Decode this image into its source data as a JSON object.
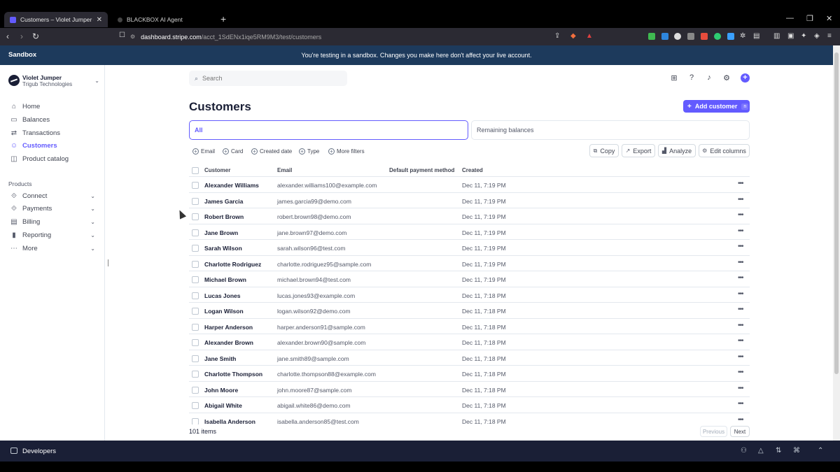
{
  "browser": {
    "tabs": [
      {
        "title": "Customers – Violet Jumper – Stri",
        "active": true
      },
      {
        "title": "BLACKBOX AI Agent",
        "active": false
      }
    ],
    "url_host": "dashboard.stripe.com",
    "url_path": "/acct_1SdENx1iqe5RM9M3/test/customers"
  },
  "banner": {
    "label": "Sandbox",
    "message": "You're testing in a sandbox. Changes you make here don't affect your live account."
  },
  "account": {
    "name": "Violet Jumper",
    "company": "Trigub Technologies"
  },
  "sidebar": {
    "items": [
      {
        "label": "Home",
        "icon": "home-icon"
      },
      {
        "label": "Balances",
        "icon": "balances-icon"
      },
      {
        "label": "Transactions",
        "icon": "transactions-icon"
      },
      {
        "label": "Customers",
        "icon": "customers-icon",
        "active": true
      },
      {
        "label": "Product catalog",
        "icon": "product-catalog-icon"
      }
    ],
    "products_label": "Products",
    "products": [
      {
        "label": "Connect",
        "icon": "connect-icon"
      },
      {
        "label": "Payments",
        "icon": "payments-icon"
      },
      {
        "label": "Billing",
        "icon": "billing-icon"
      },
      {
        "label": "Reporting",
        "icon": "reporting-icon"
      },
      {
        "label": "More",
        "icon": "more-icon"
      }
    ]
  },
  "search": {
    "placeholder": "Search"
  },
  "page": {
    "title": "Customers",
    "add_button": "Add customer",
    "add_shortcut": "n"
  },
  "segments": {
    "all": "All",
    "remaining": "Remaining balances"
  },
  "filters": [
    "Email",
    "Card",
    "Created date",
    "Type",
    "More filters"
  ],
  "actions": [
    "Copy",
    "Export",
    "Analyze",
    "Edit columns"
  ],
  "table": {
    "columns": [
      "Customer",
      "Email",
      "Default payment method",
      "Created"
    ],
    "rows": [
      {
        "name": "Alexander Williams",
        "email": "alexander.williams100@example.com",
        "created": "Dec 11, 7:19 PM"
      },
      {
        "name": "James Garcia",
        "email": "james.garcia99@demo.com",
        "created": "Dec 11, 7:19 PM"
      },
      {
        "name": "Robert Brown",
        "email": "robert.brown98@demo.com",
        "created": "Dec 11, 7:19 PM"
      },
      {
        "name": "Jane Brown",
        "email": "jane.brown97@demo.com",
        "created": "Dec 11, 7:19 PM"
      },
      {
        "name": "Sarah Wilson",
        "email": "sarah.wilson96@test.com",
        "created": "Dec 11, 7:19 PM"
      },
      {
        "name": "Charlotte Rodriguez",
        "email": "charlotte.rodriguez95@sample.com",
        "created": "Dec 11, 7:19 PM"
      },
      {
        "name": "Michael Brown",
        "email": "michael.brown94@test.com",
        "created": "Dec 11, 7:19 PM"
      },
      {
        "name": "Lucas Jones",
        "email": "lucas.jones93@example.com",
        "created": "Dec 11, 7:18 PM"
      },
      {
        "name": "Logan Wilson",
        "email": "logan.wilson92@demo.com",
        "created": "Dec 11, 7:18 PM"
      },
      {
        "name": "Harper Anderson",
        "email": "harper.anderson91@sample.com",
        "created": "Dec 11, 7:18 PM"
      },
      {
        "name": "Alexander Brown",
        "email": "alexander.brown90@sample.com",
        "created": "Dec 11, 7:18 PM"
      },
      {
        "name": "Jane Smith",
        "email": "jane.smith89@sample.com",
        "created": "Dec 11, 7:18 PM"
      },
      {
        "name": "Charlotte Thompson",
        "email": "charlotte.thompson88@example.com",
        "created": "Dec 11, 7:18 PM"
      },
      {
        "name": "John Moore",
        "email": "john.moore87@sample.com",
        "created": "Dec 11, 7:18 PM"
      },
      {
        "name": "Abigail White",
        "email": "abigail.white86@demo.com",
        "created": "Dec 11, 7:18 PM"
      },
      {
        "name": "Isabella Anderson",
        "email": "isabella.anderson85@test.com",
        "created": "Dec 11, 7:18 PM"
      }
    ]
  },
  "footer": {
    "count": "101 items",
    "previous": "Previous",
    "next": "Next"
  },
  "devbar": {
    "label": "Developers"
  },
  "colors": {
    "accent": "#635bff",
    "banner": "#1d3a5c",
    "devbar": "#1a1f36"
  }
}
